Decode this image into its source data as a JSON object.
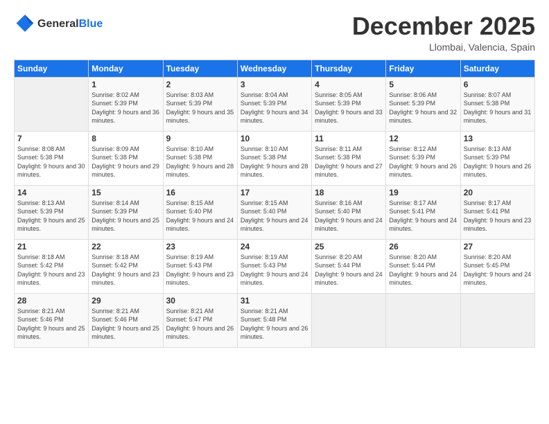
{
  "header": {
    "logo_general": "General",
    "logo_blue": "Blue",
    "month_year": "December 2025",
    "location": "Llombai, Valencia, Spain"
  },
  "weekdays": [
    "Sunday",
    "Monday",
    "Tuesday",
    "Wednesday",
    "Thursday",
    "Friday",
    "Saturday"
  ],
  "weeks": [
    [
      {
        "day": "",
        "empty": true
      },
      {
        "day": "1",
        "sunrise": "Sunrise: 8:02 AM",
        "sunset": "Sunset: 5:39 PM",
        "daylight": "Daylight: 9 hours and 36 minutes."
      },
      {
        "day": "2",
        "sunrise": "Sunrise: 8:03 AM",
        "sunset": "Sunset: 5:39 PM",
        "daylight": "Daylight: 9 hours and 35 minutes."
      },
      {
        "day": "3",
        "sunrise": "Sunrise: 8:04 AM",
        "sunset": "Sunset: 5:39 PM",
        "daylight": "Daylight: 9 hours and 34 minutes."
      },
      {
        "day": "4",
        "sunrise": "Sunrise: 8:05 AM",
        "sunset": "Sunset: 5:39 PM",
        "daylight": "Daylight: 9 hours and 33 minutes."
      },
      {
        "day": "5",
        "sunrise": "Sunrise: 8:06 AM",
        "sunset": "Sunset: 5:39 PM",
        "daylight": "Daylight: 9 hours and 32 minutes."
      },
      {
        "day": "6",
        "sunrise": "Sunrise: 8:07 AM",
        "sunset": "Sunset: 5:38 PM",
        "daylight": "Daylight: 9 hours and 31 minutes."
      }
    ],
    [
      {
        "day": "7",
        "sunrise": "Sunrise: 8:08 AM",
        "sunset": "Sunset: 5:38 PM",
        "daylight": "Daylight: 9 hours and 30 minutes."
      },
      {
        "day": "8",
        "sunrise": "Sunrise: 8:09 AM",
        "sunset": "Sunset: 5:38 PM",
        "daylight": "Daylight: 9 hours and 29 minutes."
      },
      {
        "day": "9",
        "sunrise": "Sunrise: 8:10 AM",
        "sunset": "Sunset: 5:38 PM",
        "daylight": "Daylight: 9 hours and 28 minutes."
      },
      {
        "day": "10",
        "sunrise": "Sunrise: 8:10 AM",
        "sunset": "Sunset: 5:38 PM",
        "daylight": "Daylight: 9 hours and 28 minutes."
      },
      {
        "day": "11",
        "sunrise": "Sunrise: 8:11 AM",
        "sunset": "Sunset: 5:38 PM",
        "daylight": "Daylight: 9 hours and 27 minutes."
      },
      {
        "day": "12",
        "sunrise": "Sunrise: 8:12 AM",
        "sunset": "Sunset: 5:39 PM",
        "daylight": "Daylight: 9 hours and 26 minutes."
      },
      {
        "day": "13",
        "sunrise": "Sunrise: 8:13 AM",
        "sunset": "Sunset: 5:39 PM",
        "daylight": "Daylight: 9 hours and 26 minutes."
      }
    ],
    [
      {
        "day": "14",
        "sunrise": "Sunrise: 8:13 AM",
        "sunset": "Sunset: 5:39 PM",
        "daylight": "Daylight: 9 hours and 25 minutes."
      },
      {
        "day": "15",
        "sunrise": "Sunrise: 8:14 AM",
        "sunset": "Sunset: 5:39 PM",
        "daylight": "Daylight: 9 hours and 25 minutes."
      },
      {
        "day": "16",
        "sunrise": "Sunrise: 8:15 AM",
        "sunset": "Sunset: 5:40 PM",
        "daylight": "Daylight: 9 hours and 24 minutes."
      },
      {
        "day": "17",
        "sunrise": "Sunrise: 8:15 AM",
        "sunset": "Sunset: 5:40 PM",
        "daylight": "Daylight: 9 hours and 24 minutes."
      },
      {
        "day": "18",
        "sunrise": "Sunrise: 8:16 AM",
        "sunset": "Sunset: 5:40 PM",
        "daylight": "Daylight: 9 hours and 24 minutes."
      },
      {
        "day": "19",
        "sunrise": "Sunrise: 8:17 AM",
        "sunset": "Sunset: 5:41 PM",
        "daylight": "Daylight: 9 hours and 24 minutes."
      },
      {
        "day": "20",
        "sunrise": "Sunrise: 8:17 AM",
        "sunset": "Sunset: 5:41 PM",
        "daylight": "Daylight: 9 hours and 23 minutes."
      }
    ],
    [
      {
        "day": "21",
        "sunrise": "Sunrise: 8:18 AM",
        "sunset": "Sunset: 5:42 PM",
        "daylight": "Daylight: 9 hours and 23 minutes."
      },
      {
        "day": "22",
        "sunrise": "Sunrise: 8:18 AM",
        "sunset": "Sunset: 5:42 PM",
        "daylight": "Daylight: 9 hours and 23 minutes."
      },
      {
        "day": "23",
        "sunrise": "Sunrise: 8:19 AM",
        "sunset": "Sunset: 5:43 PM",
        "daylight": "Daylight: 9 hours and 23 minutes."
      },
      {
        "day": "24",
        "sunrise": "Sunrise: 8:19 AM",
        "sunset": "Sunset: 5:43 PM",
        "daylight": "Daylight: 9 hours and 24 minutes."
      },
      {
        "day": "25",
        "sunrise": "Sunrise: 8:20 AM",
        "sunset": "Sunset: 5:44 PM",
        "daylight": "Daylight: 9 hours and 24 minutes."
      },
      {
        "day": "26",
        "sunrise": "Sunrise: 8:20 AM",
        "sunset": "Sunset: 5:44 PM",
        "daylight": "Daylight: 9 hours and 24 minutes."
      },
      {
        "day": "27",
        "sunrise": "Sunrise: 8:20 AM",
        "sunset": "Sunset: 5:45 PM",
        "daylight": "Daylight: 9 hours and 24 minutes."
      }
    ],
    [
      {
        "day": "28",
        "sunrise": "Sunrise: 8:21 AM",
        "sunset": "Sunset: 5:46 PM",
        "daylight": "Daylight: 9 hours and 25 minutes."
      },
      {
        "day": "29",
        "sunrise": "Sunrise: 8:21 AM",
        "sunset": "Sunset: 5:46 PM",
        "daylight": "Daylight: 9 hours and 25 minutes."
      },
      {
        "day": "30",
        "sunrise": "Sunrise: 8:21 AM",
        "sunset": "Sunset: 5:47 PM",
        "daylight": "Daylight: 9 hours and 26 minutes."
      },
      {
        "day": "31",
        "sunrise": "Sunrise: 8:21 AM",
        "sunset": "Sunset: 5:48 PM",
        "daylight": "Daylight: 9 hours and 26 minutes."
      },
      {
        "day": "",
        "empty": true
      },
      {
        "day": "",
        "empty": true
      },
      {
        "day": "",
        "empty": true
      }
    ]
  ]
}
